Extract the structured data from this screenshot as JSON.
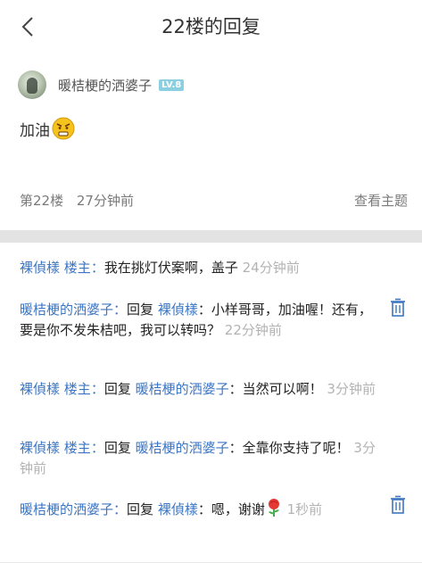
{
  "header": {
    "title": "22楼的回复",
    "back_icon": "chevron-left-icon"
  },
  "post": {
    "author": "暖桔梗的洒婆子",
    "level": "LV.8",
    "content": "加油",
    "emoji": "angry-face-emoji",
    "floor": "第22楼",
    "time": "27分钟前",
    "view_topic": "查看主题"
  },
  "replies": [
    {
      "name": "裸偵樣",
      "tag": "楼主",
      "colon": "：",
      "prefix": "",
      "text": "我在挑灯伏案啊，盖子",
      "time": "24分钟前",
      "deletable": false
    },
    {
      "name": "暖桔梗的洒婆子",
      "tag": "",
      "colon": "：",
      "prefix": "回复 ",
      "target": "裸偵樣",
      "text": "：小样哥哥，加油喔！还有，要是你不发朱桔吧，我可以转吗？",
      "time": "22分钟前",
      "deletable": true
    },
    {
      "name": "裸偵樣",
      "tag": "楼主",
      "colon": "：",
      "prefix": "回复 ",
      "target": "暖桔梗的洒婆子",
      "text": "：当然可以啊！",
      "time": "3分钟前",
      "deletable": false
    },
    {
      "name": "裸偵樣",
      "tag": "楼主",
      "colon": "：",
      "prefix": "回复 ",
      "target": "暖桔梗的洒婆子",
      "text": "：全靠你支持了呢！",
      "time": "3分钟前",
      "deletable": false
    },
    {
      "name": "暖桔梗的洒婆子",
      "tag": "",
      "colon": "：",
      "prefix": "回复 ",
      "target": "裸偵樣",
      "text": "：嗯，谢谢",
      "emoji": "rose-emoji",
      "time": "1秒前",
      "deletable": true
    }
  ],
  "colors": {
    "name_blue": "#3c76c2",
    "time_gray": "#b3b3b3",
    "level_badge": "#8ad0e0"
  }
}
